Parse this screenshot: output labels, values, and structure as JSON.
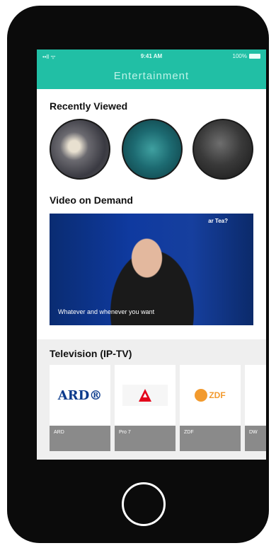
{
  "status_bar": {
    "signal": "••ll ᯤ",
    "time": "9:41 AM",
    "battery": "100%"
  },
  "header": {
    "title": "Entertainment"
  },
  "recently_viewed": {
    "title": "Recently Viewed"
  },
  "video_on_demand": {
    "title": "Video on Demand",
    "corner_text": "ar Tea?",
    "caption": "Whatever and whenever you want"
  },
  "television": {
    "title": "Television (IP-TV)",
    "channels": [
      {
        "logo": "ARD®",
        "label": "ARD"
      },
      {
        "logo": "pro7",
        "label": "Pro 7"
      },
      {
        "logo": "ZDF",
        "label": "ZDF"
      },
      {
        "logo": "",
        "label": "DW"
      }
    ]
  },
  "colors": {
    "accent": "#21bfa5",
    "ard_blue": "#0a3a8c",
    "zdf_orange": "#f29a2e",
    "pro7_red": "#e3051b"
  }
}
